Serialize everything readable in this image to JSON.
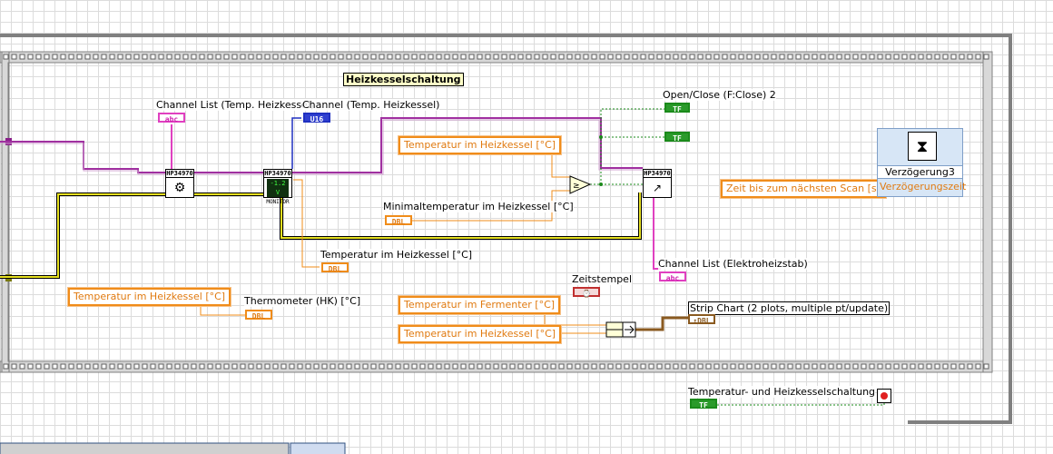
{
  "frame_title": "Heizkesselschaltung",
  "labels": {
    "channel_list_temp": "Channel List (Temp. Heizkessel)",
    "channel_temp": "Channel (Temp. Heizkessel)",
    "open_close": "Open/Close (F:Close) 2",
    "minimaltemperatur": "Minimaltemperatur im Heizkessel [°C]",
    "temperatur_heizkessel_ind": "Temperatur im Heizkessel [°C]",
    "thermometer": "Thermometer (HK) [°C]",
    "zeitstempel": "Zeitstempel",
    "channel_list_elektro": "Channel List (Elektroheizstab)",
    "strip_chart": "Strip Chart (2 plots, multiple pt/update)",
    "stop_label": "Temperatur- und Heizkesselschaltung"
  },
  "locals": {
    "temp_heizkessel_1": "Temperatur im Heizkessel [°C]",
    "temp_heizkessel_2": "Temperatur im Heizkessel [°C]",
    "temp_fermenter": "Temperatur im Fermenter [°C]",
    "temp_heizkessel_3": "Temperatur im Heizkessel [°C]",
    "zeit_scan": "Zeit bis zum nächsten Scan [s]"
  },
  "terminals": {
    "abc": "abc",
    "u16": "U16",
    "tf": "TF",
    "dbl": "DBL",
    "chart": "↑DBL",
    "timestamp": "⌚"
  },
  "vis": {
    "hp_name": "HP34970",
    "monitor_value": "-1.2 V",
    "monitor_label": "MONITOR"
  },
  "wait_node": {
    "name": "Verzögerung3",
    "property": "Verzögerungszeit"
  },
  "colors": {
    "numeric_wire": "#f08c1a",
    "string_wire": "#e040c0",
    "boolean_wire": "#1a8a1a",
    "error_wire": "#c8c820",
    "refnum_wire": "#a030a0",
    "frame_gray": "#808080"
  }
}
